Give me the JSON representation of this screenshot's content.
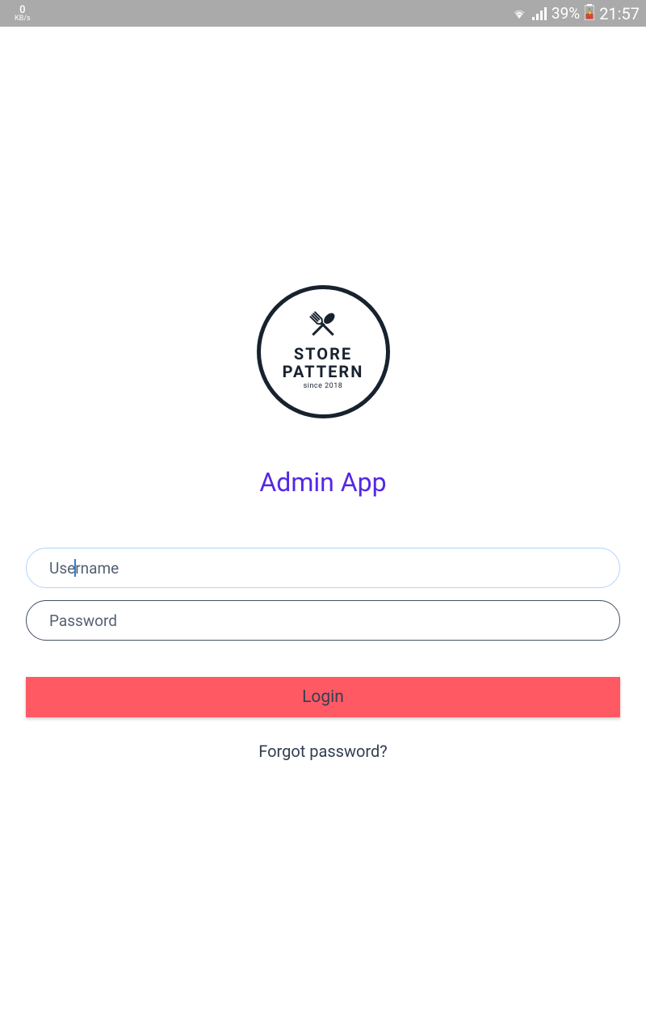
{
  "status_bar": {
    "data_speed": "0",
    "data_unit": "KB/s",
    "battery": "39%",
    "time": "21:57"
  },
  "logo": {
    "line1": "STORE",
    "line2": "PATTERN",
    "since": "since 2018"
  },
  "page": {
    "title": "Admin App"
  },
  "form": {
    "username_placeholder": "Username",
    "password_placeholder": "Password",
    "login_button": "Login",
    "forgot_link": "Forgot password?"
  },
  "colors": {
    "accent": "#5428e4",
    "button": "#ff5964",
    "text": "#323f52",
    "status_bg": "#aaaaaa"
  }
}
